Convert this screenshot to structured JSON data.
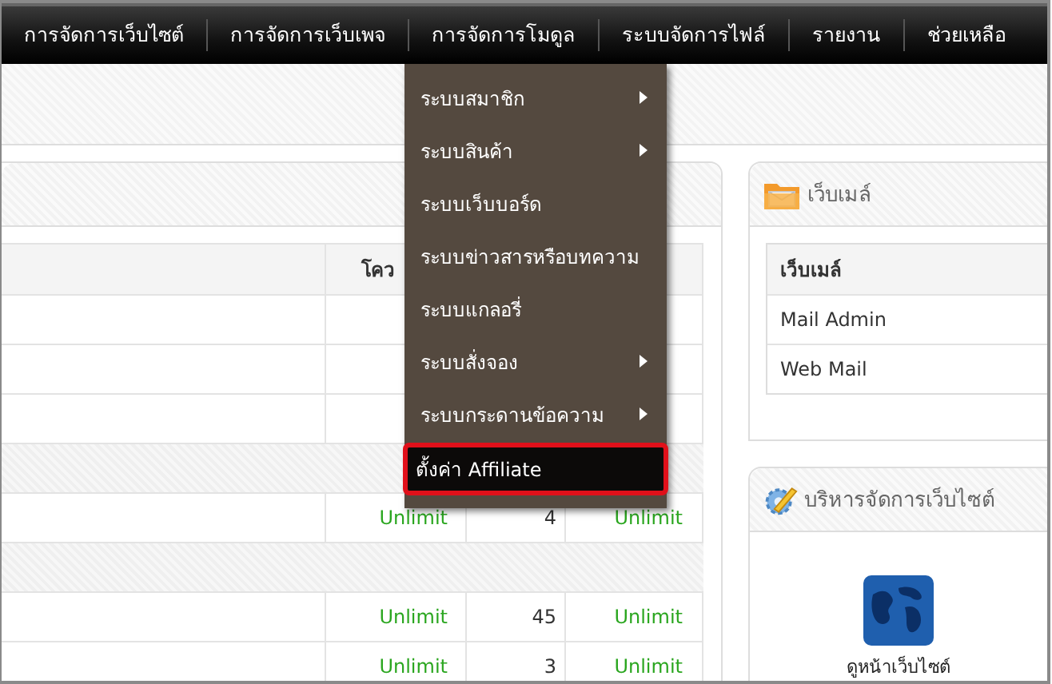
{
  "nav": [
    {
      "label": "การจัดการเว็บไซต์"
    },
    {
      "label": "การจัดการเว็บเพจ"
    },
    {
      "label": "การจัดการโมดูล"
    },
    {
      "label": "ระบบจัดการไฟล์"
    },
    {
      "label": "รายงาน"
    },
    {
      "label": "ช่วยเหลือ"
    }
  ],
  "menu": [
    {
      "label": "ระบบสมาชิก",
      "submenu": true,
      "selected": false
    },
    {
      "label": "ระบบสินค้า",
      "submenu": true,
      "selected": false
    },
    {
      "label": "ระบบเว็บบอร์ด",
      "submenu": false,
      "selected": false
    },
    {
      "label": "ระบบข่าวสารหรือบทความ",
      "submenu": false,
      "selected": false
    },
    {
      "label": "ระบบแกลอรี่",
      "submenu": false,
      "selected": false
    },
    {
      "label": "ระบบสั่งจอง",
      "submenu": true,
      "selected": false
    },
    {
      "label": "ระบบกระดานข้อความ",
      "submenu": true,
      "selected": false
    },
    {
      "label": "ตั้งค่า Affiliate",
      "submenu": false,
      "selected": true
    }
  ],
  "quota_table": {
    "header": "โคว",
    "rows": [
      {
        "kind": "covered"
      },
      {
        "kind": "covered"
      },
      {
        "kind": "covered"
      },
      {
        "kind": "group"
      },
      {
        "kind": "data",
        "cells": [
          "Unlimit",
          "4",
          "Unlimit"
        ]
      },
      {
        "kind": "group"
      },
      {
        "kind": "data",
        "cells": [
          "Unlimit",
          "45",
          "Unlimit"
        ]
      },
      {
        "kind": "data",
        "cells": [
          "Unlimit",
          "3",
          "Unlimit"
        ]
      }
    ]
  },
  "webmail": {
    "title": "เว็บเมล์",
    "column": "เว็บเมล์",
    "rows": [
      "Mail Admin",
      "Web Mail"
    ]
  },
  "site_admin": {
    "title": "บริหารจัดการเว็บไซต์",
    "link": "ดูหน้าเว็บไซต์"
  }
}
